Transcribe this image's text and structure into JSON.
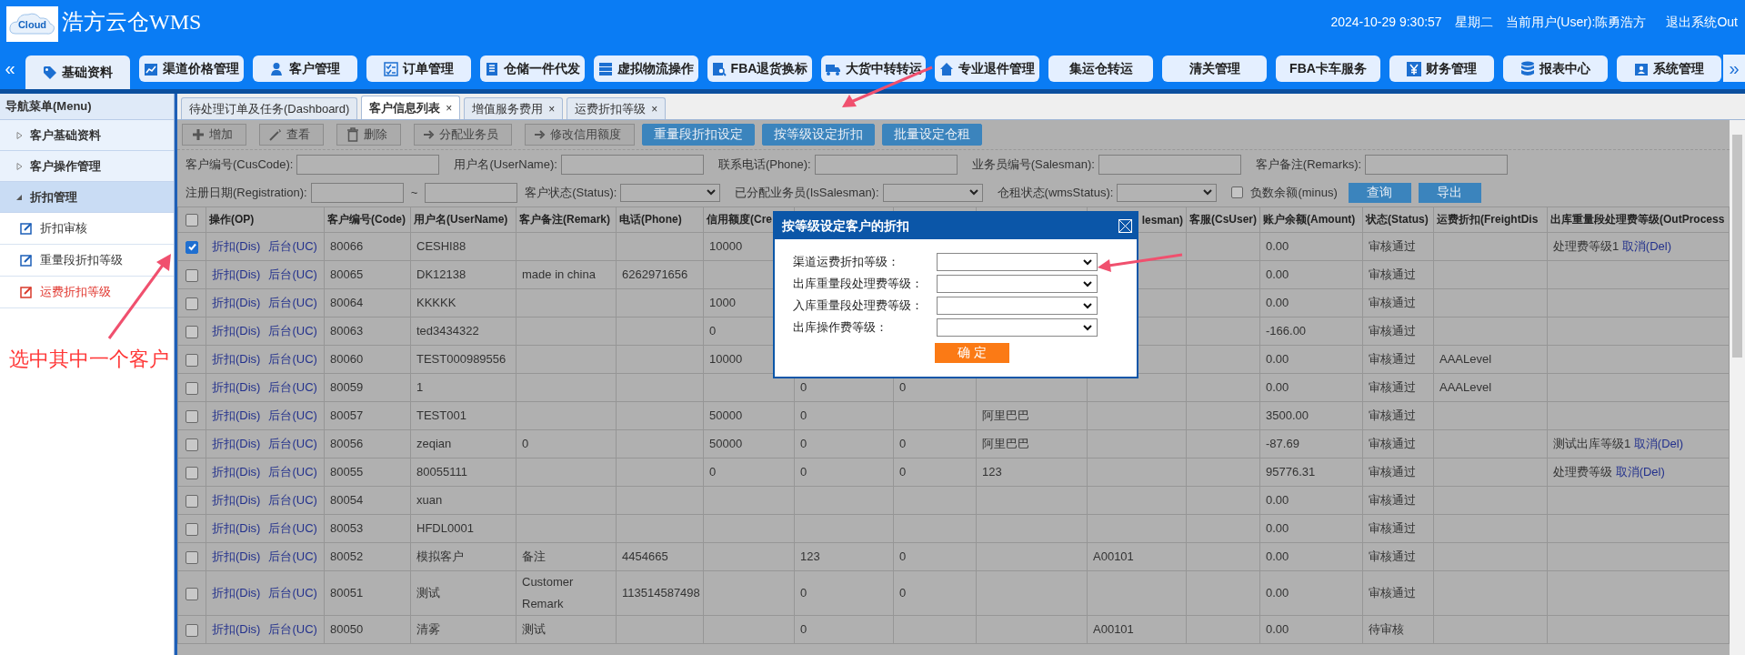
{
  "header": {
    "logo_badge": "Cloud",
    "app_title": "浩方云仓WMS",
    "datetime": "2024-10-29 9:30:57",
    "weekday": "星期二",
    "current_user": "当前用户(User):陈勇浩方",
    "logout": "退出系统Out"
  },
  "main_nav": {
    "prev": "«",
    "next": "»",
    "items": [
      {
        "label": "基础资料",
        "selected": true
      },
      {
        "label": "渠道价格管理",
        "selected": false
      },
      {
        "label": "客户管理",
        "selected": false
      },
      {
        "label": "订单管理",
        "selected": false
      },
      {
        "label": "仓储一件代发",
        "selected": false
      },
      {
        "label": "虚拟物流操作",
        "selected": false
      },
      {
        "label": "FBA退货换标",
        "selected": false
      },
      {
        "label": "大货中转转运",
        "selected": false
      },
      {
        "label": "专业退件管理",
        "selected": false
      },
      {
        "label": "集运仓转运",
        "selected": false
      },
      {
        "label": "清关管理",
        "selected": false
      },
      {
        "label": "FBA卡车服务",
        "selected": false
      },
      {
        "label": "财务管理",
        "selected": false
      },
      {
        "label": "报表中心",
        "selected": false
      },
      {
        "label": "系统管理",
        "selected": false
      }
    ]
  },
  "sidebar": {
    "title": "导航菜单(Menu)",
    "items": [
      {
        "label": "客户基础资料",
        "expanded": false
      },
      {
        "label": "客户操作管理",
        "expanded": false
      },
      {
        "label": "折扣管理",
        "expanded": true,
        "children": [
          {
            "label": "折扣审核",
            "selected": false
          },
          {
            "label": "重量段折扣等级",
            "selected": false
          },
          {
            "label": "运费折扣等级",
            "selected": true
          }
        ]
      }
    ]
  },
  "tabs": [
    {
      "label": "待处理订单及任务(Dashboard)",
      "selected": false
    },
    {
      "label": "客户信息列表",
      "close": "×",
      "selected": true
    },
    {
      "label": "增值服务费用",
      "close": "×",
      "selected": false
    },
    {
      "label": "运费折扣等级",
      "close": "×",
      "selected": false
    }
  ],
  "toolbar": [
    {
      "label": "增加",
      "kind": "plain"
    },
    {
      "label": "查看",
      "kind": "plain"
    },
    {
      "label": "删除",
      "kind": "plain"
    },
    {
      "label": "分配业务员",
      "kind": "plain"
    },
    {
      "label": "修改信用额度",
      "kind": "plain"
    },
    {
      "label": "重量段折扣设定",
      "kind": "primary"
    },
    {
      "label": "按等级设定折扣",
      "kind": "primary"
    },
    {
      "label": "批量设定仓租",
      "kind": "primary"
    }
  ],
  "filters": [
    [
      {
        "label": "客户编号(CusCode):",
        "kind": "input"
      },
      {
        "label": "用户名(UserName):",
        "kind": "input"
      },
      {
        "label": "联系电话(Phone):",
        "kind": "input"
      },
      {
        "label": "业务员编号(Salesman):",
        "kind": "input"
      },
      {
        "label": "客户备注(Remarks):",
        "kind": "input"
      }
    ],
    [
      {
        "label": "注册日期(Registration):",
        "kind": "date_range",
        "separator": "~"
      },
      {
        "label": "客户状态(Status):",
        "kind": "select"
      },
      {
        "label": "已分配业务员(IsSalesman):",
        "kind": "select"
      },
      {
        "label": "仓租状态(wmsStatus):",
        "kind": "select"
      },
      {
        "label": "负数余额(minus)",
        "kind": "checkbox",
        "checked": false
      },
      {
        "label": "查询",
        "kind": "button"
      },
      {
        "label": "导出",
        "kind": "button"
      }
    ]
  ],
  "table": {
    "columns": [
      {
        "kind": "checkbox",
        "checked": false
      },
      {
        "label": "操作(OP)"
      },
      {
        "label": "客户编号(Code)"
      },
      {
        "label": "用户名(UserName)"
      },
      {
        "label": "客户备注(Remark)"
      },
      {
        "label": "电话(Phone)"
      },
      {
        "label": "信用额度(Cre"
      },
      {},
      {},
      {},
      {
        "label": "lesman)",
        "tail": true
      },
      {
        "label": "客服(CsUser)"
      },
      {
        "label": "账户余额(Amount)"
      },
      {
        "label": "状态(Status)"
      },
      {
        "label": "运费折扣(FreightDis"
      },
      {
        "label": "出库重量段处理费等级(OutProcess"
      }
    ],
    "rows": [
      {
        "cells": [
          {
            "kind": "checkbox",
            "checked": true
          },
          {
            "kind": "links",
            "links": [
              "折扣(Dis)",
              "后台(UC)"
            ]
          },
          "80066",
          "CESHI88",
          null,
          null,
          "10000",
          null,
          null,
          null,
          null,
          null,
          "0.00",
          "审核通过",
          null,
          {
            "kind": "text_link",
            "text": "处理费等级1",
            "link": "取消(Del)"
          }
        ]
      },
      {
        "cells": [
          {
            "kind": "checkbox",
            "checked": false
          },
          {
            "kind": "links",
            "links": [
              "折扣(Dis)",
              "后台(UC)"
            ]
          },
          "80065",
          "DK12138",
          "made in china",
          "6262971656",
          null,
          null,
          null,
          null,
          null,
          null,
          "0.00",
          "审核通过",
          null,
          null
        ]
      },
      {
        "cells": [
          {
            "kind": "checkbox",
            "checked": false
          },
          {
            "kind": "links",
            "links": [
              "折扣(Dis)",
              "后台(UC)"
            ]
          },
          "80064",
          "KKKKK",
          null,
          null,
          "1000",
          null,
          null,
          null,
          null,
          null,
          "0.00",
          "审核通过",
          null,
          null
        ]
      },
      {
        "cells": [
          {
            "kind": "checkbox",
            "checked": false
          },
          {
            "kind": "links",
            "links": [
              "折扣(Dis)",
              "后台(UC)"
            ]
          },
          "80063",
          "ted3434322",
          null,
          null,
          "0",
          null,
          null,
          null,
          null,
          null,
          "-166.00",
          "审核通过",
          null,
          null
        ]
      },
      {
        "cells": [
          {
            "kind": "checkbox",
            "checked": false
          },
          {
            "kind": "links",
            "links": [
              "折扣(Dis)",
              "后台(UC)"
            ]
          },
          "80060",
          "TEST000989556",
          null,
          null,
          "10000",
          null,
          null,
          null,
          null,
          null,
          "0.00",
          "审核通过",
          "AAALevel",
          null
        ]
      },
      {
        "cells": [
          {
            "kind": "checkbox",
            "checked": false
          },
          {
            "kind": "links",
            "links": [
              "折扣(Dis)",
              "后台(UC)"
            ]
          },
          "80059",
          "1",
          null,
          null,
          null,
          "0",
          "0",
          null,
          null,
          null,
          "0.00",
          "审核通过",
          "AAALevel",
          null
        ]
      },
      {
        "cells": [
          {
            "kind": "checkbox",
            "checked": false
          },
          {
            "kind": "links",
            "links": [
              "折扣(Dis)",
              "后台(UC)"
            ]
          },
          "80057",
          "TEST001",
          null,
          null,
          "50000",
          "0",
          null,
          "阿里巴巴",
          null,
          null,
          "3500.00",
          "审核通过",
          null,
          null
        ]
      },
      {
        "cells": [
          {
            "kind": "checkbox",
            "checked": false
          },
          {
            "kind": "links",
            "links": [
              "折扣(Dis)",
              "后台(UC)"
            ]
          },
          "80056",
          "zeqian",
          "0",
          null,
          "50000",
          "0",
          "0",
          "阿里巴巴",
          null,
          null,
          "-87.69",
          "审核通过",
          null,
          {
            "kind": "text_link",
            "text": "测试出库等级1",
            "link": "取消(Del)"
          }
        ]
      },
      {
        "cells": [
          {
            "kind": "checkbox",
            "checked": false
          },
          {
            "kind": "links",
            "links": [
              "折扣(Dis)",
              "后台(UC)"
            ]
          },
          "80055",
          "80055111",
          null,
          null,
          "0",
          "0",
          "0",
          "123",
          null,
          null,
          "95776.31",
          "审核通过",
          null,
          {
            "kind": "text_link",
            "text": "处理费等级",
            "link": "取消(Del)"
          }
        ]
      },
      {
        "cells": [
          {
            "kind": "checkbox",
            "checked": false
          },
          {
            "kind": "links",
            "links": [
              "折扣(Dis)",
              "后台(UC)"
            ]
          },
          "80054",
          "xuan",
          null,
          null,
          null,
          null,
          null,
          null,
          null,
          null,
          "0.00",
          "审核通过",
          null,
          null
        ]
      },
      {
        "cells": [
          {
            "kind": "checkbox",
            "checked": false
          },
          {
            "kind": "links",
            "links": [
              "折扣(Dis)",
              "后台(UC)"
            ]
          },
          "80053",
          "HFDL0001",
          null,
          null,
          null,
          null,
          null,
          null,
          null,
          null,
          "0.00",
          "审核通过",
          null,
          null
        ]
      },
      {
        "cells": [
          {
            "kind": "checkbox",
            "checked": false
          },
          {
            "kind": "links",
            "links": [
              "折扣(Dis)",
              "后台(UC)"
            ]
          },
          "80052",
          "模拟客户",
          "备注",
          "4454665",
          null,
          "123",
          "0",
          null,
          "A00101",
          null,
          "0.00",
          "审核通过",
          null,
          null
        ]
      },
      {
        "cells": [
          {
            "kind": "checkbox",
            "checked": false
          },
          {
            "kind": "links",
            "links": [
              "折扣(Dis)",
              "后台(UC)"
            ]
          },
          "80051",
          "测试",
          "Customer Remark",
          "113514587498",
          null,
          "0",
          "0",
          null,
          null,
          null,
          "0.00",
          "审核通过",
          null,
          null
        ]
      },
      {
        "cells": [
          {
            "kind": "checkbox",
            "checked": false
          },
          {
            "kind": "links",
            "links": [
              "折扣(Dis)",
              "后台(UC)"
            ]
          },
          "80050",
          "清雾",
          "测试",
          null,
          null,
          "0",
          null,
          null,
          "A00101",
          null,
          "0.00",
          "待审核",
          null,
          null
        ]
      }
    ]
  },
  "dialog": {
    "title": "按等级设定客户的折扣",
    "fields": [
      {
        "label": "渠道运费折扣等级："
      },
      {
        "label": "出库重量段处理费等级："
      },
      {
        "label": "入库重量段处理费等级："
      },
      {
        "label": "出库操作费等级："
      }
    ],
    "confirm": "确 定"
  },
  "annotation": {
    "text": "选中其中一个客户"
  }
}
